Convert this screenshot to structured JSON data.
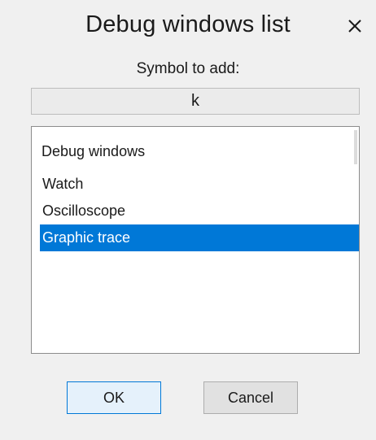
{
  "dialog": {
    "title": "Debug windows list",
    "close_glyph": "×",
    "close_icon": "close-icon"
  },
  "symbol": {
    "label": "Symbol to add:",
    "value": "k"
  },
  "debug_list": {
    "header": "Debug windows",
    "items": [
      {
        "label": "Watch",
        "selected": false
      },
      {
        "label": "Oscilloscope",
        "selected": false
      },
      {
        "label": "Graphic trace",
        "selected": true
      }
    ],
    "selection_color": "#0078d7"
  },
  "buttons": {
    "ok_label": "OK",
    "cancel_label": "Cancel"
  }
}
